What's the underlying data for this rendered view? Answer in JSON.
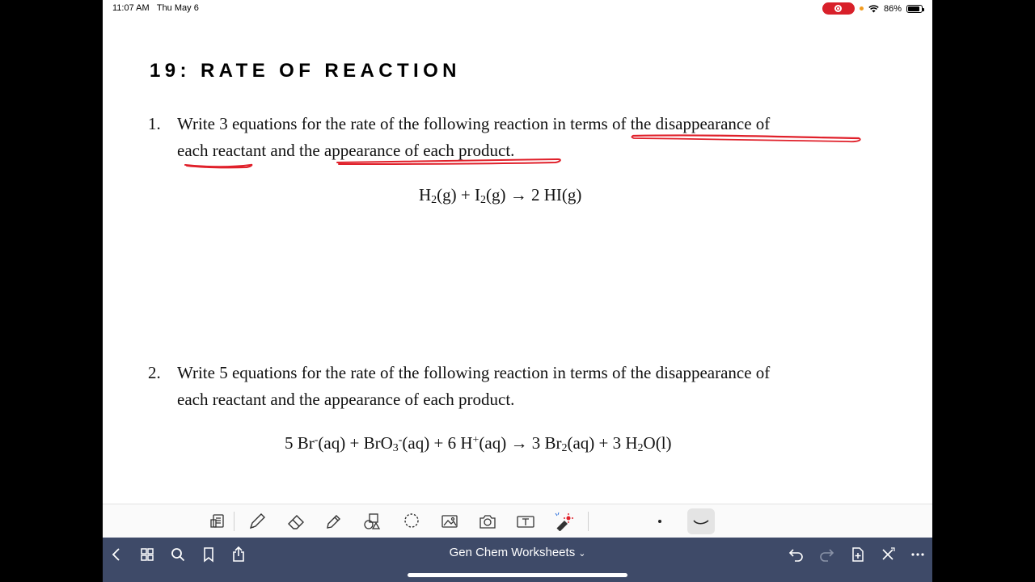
{
  "status_bar": {
    "time": "11:07 AM",
    "date": "Thu May 6",
    "battery": "86%",
    "battery_level": 0.86
  },
  "document": {
    "title": "19: RATE OF REACTION",
    "questions": [
      {
        "number": "1.",
        "line1": "Write 3 equations for the rate of the following reaction in terms of the disappearance of",
        "line2": "each reactant and the appearance of each product."
      },
      {
        "number": "2.",
        "line1": "Write 5 equations for the rate of the following reaction in terms of the disappearance of",
        "line2": "each reactant and the appearance of each product."
      }
    ],
    "equation1": {
      "h": "H",
      "h_sub": "2",
      "g1": "(g) + I",
      "i_sub": "2",
      "g2": "(g) → 2 HI(g)"
    },
    "equation2": {
      "p1": "5 Br",
      "sup1": "-",
      "p2": "(aq) + BrO",
      "sub1": "3",
      "sup2": "-",
      "p3": "(aq) + 6 H",
      "sup3": "+",
      "p4": "(aq) → 3 Br",
      "sub2": "2",
      "p5": "(aq) + 3 H",
      "sub3": "2",
      "p6": "O(l)"
    }
  },
  "annotation_color": "#e0202a",
  "toolbar": {
    "tools": [
      "lasso-doc-icon",
      "pen-icon",
      "eraser-icon",
      "highlighter-icon",
      "shapes-icon",
      "lasso-icon",
      "image-icon",
      "camera-icon",
      "text-icon",
      "laser-pointer-icon"
    ]
  },
  "navbar": {
    "title": "Gen Chem Worksheets",
    "background": "#3e4a68"
  }
}
